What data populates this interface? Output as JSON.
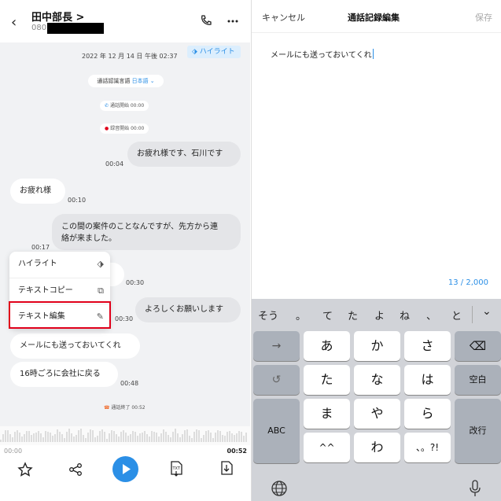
{
  "left_panel": {
    "header": {
      "contact_name": "田中部長 >",
      "contact_number": "080"
    },
    "date": "2022 年 12 月 14 日 午後 02:37",
    "highlight_badge": "ハイライト",
    "language": {
      "label": "通話認識言語",
      "value": "日本語"
    },
    "events": {
      "call_start": "通話開始 00:00",
      "rec_start": "録音開始 00:00",
      "call_end": "通話終了 00:52"
    },
    "messages": [
      {
        "text": "お疲れ様です、石川です",
        "time": "00:04"
      },
      {
        "text": "お疲れ様",
        "time": "00:10"
      },
      {
        "line1": "この間の案件のことなんですが、先方から連",
        "line2": "絡が来ました。",
        "time": "00:17"
      },
      {
        "text": "",
        "time": "00:30"
      },
      {
        "text": "よろしくお願いします",
        "time": "00:30"
      },
      {
        "text": "メールにも送っておいてくれ",
        "time": ""
      },
      {
        "text": "16時ごろに会社に戻る",
        "time": "00:48"
      }
    ],
    "context_menu": [
      {
        "label": "ハイライト",
        "icon": "tag-icon"
      },
      {
        "label": "テキストコピー",
        "icon": "copy-icon"
      },
      {
        "label": "テキスト編集",
        "icon": "pencil-icon"
      }
    ],
    "player": {
      "current": "00:00",
      "total": "00:52"
    }
  },
  "right_panel": {
    "header": {
      "cancel": "キャンセル",
      "title": "通話記録編集",
      "save": "保存"
    },
    "edit_text": "メールにも送っておいてくれ",
    "char_count": "13 / 2,000",
    "suggestions": [
      "そう",
      "。",
      "て",
      "た",
      "よ",
      "ね",
      "、",
      "と"
    ],
    "keys": {
      "row1": [
        "あ",
        "か",
        "さ"
      ],
      "row2": [
        "た",
        "な",
        "は"
      ],
      "row3": [
        "ま",
        "や",
        "ら"
      ],
      "row4": [
        "^^",
        "わ",
        "、。?!"
      ],
      "space": "空白",
      "abc": "ABC",
      "enter": "改行"
    }
  },
  "colors": {
    "accent": "#2b8fe6",
    "highlight_box": "#e0001a"
  }
}
